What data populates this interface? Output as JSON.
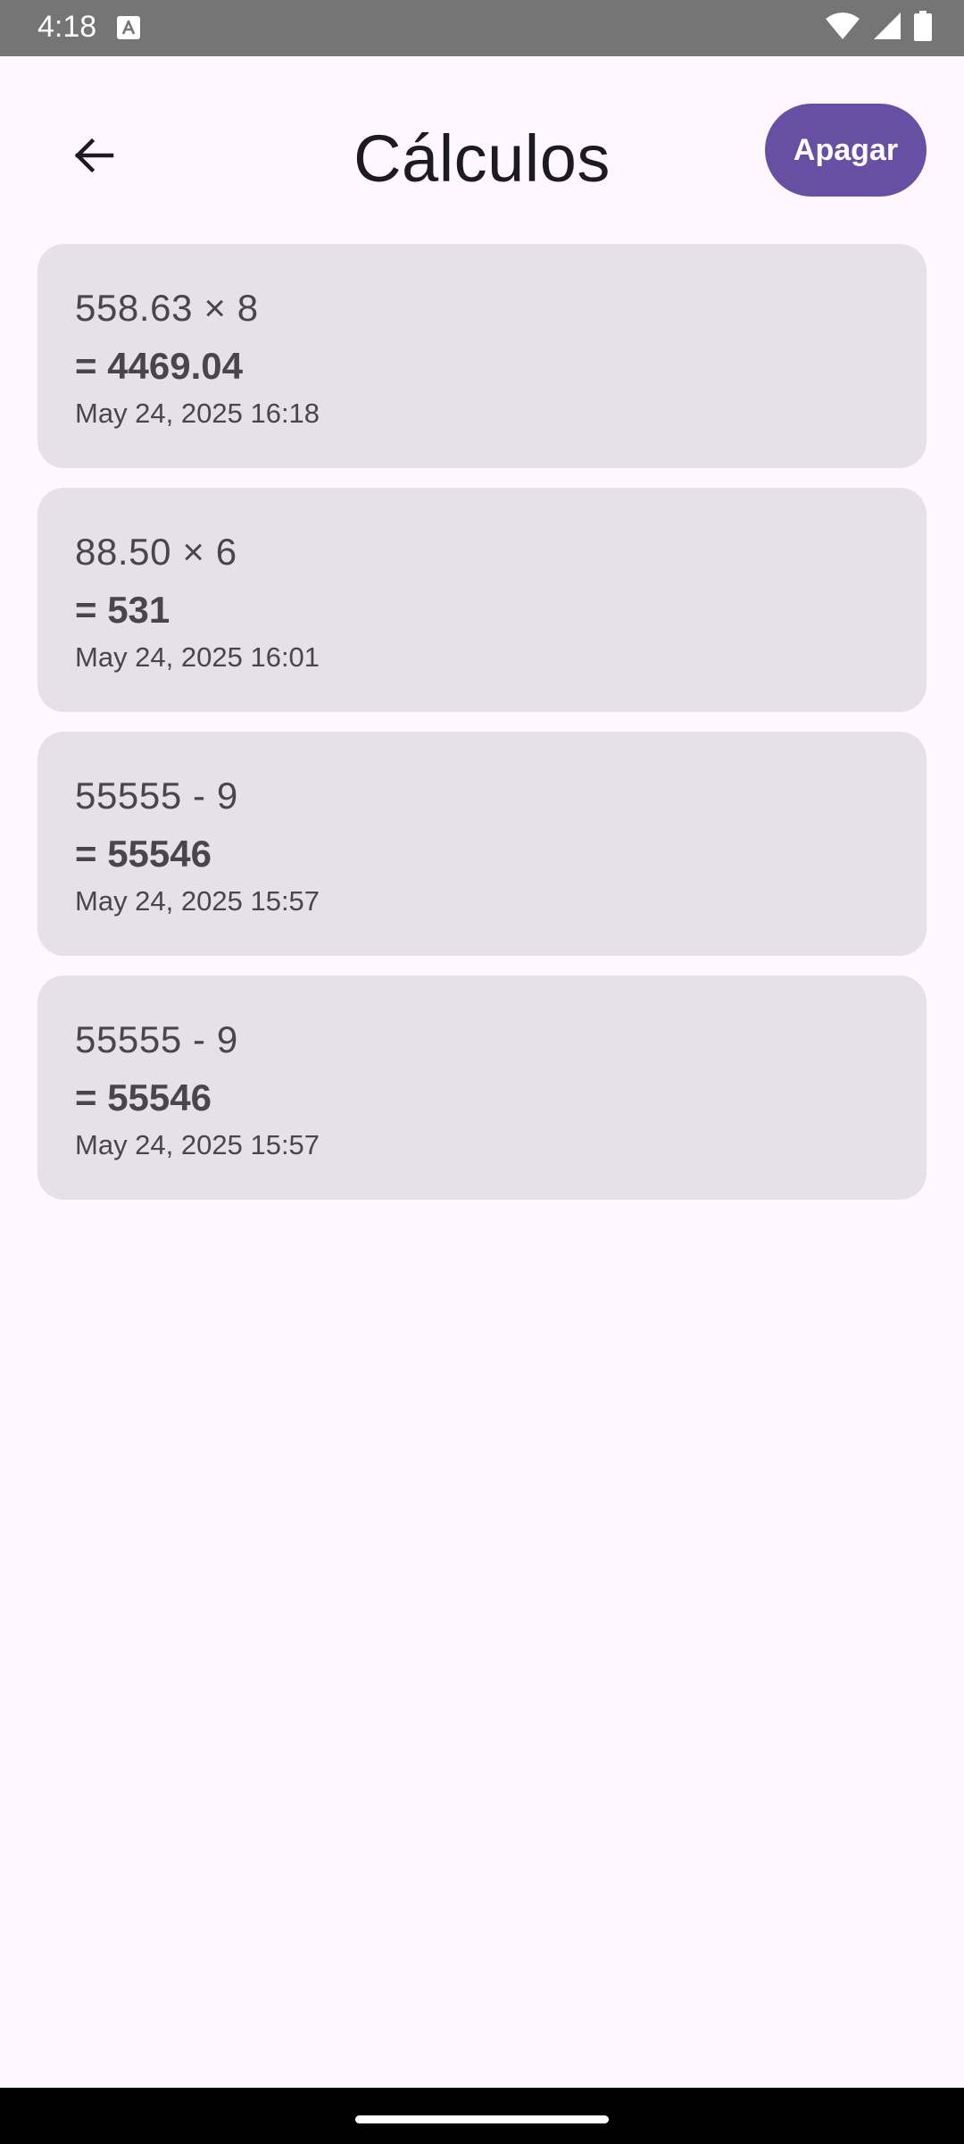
{
  "status_bar": {
    "time": "4:18"
  },
  "header": {
    "title": "Cálculos",
    "clear_label": "Apagar",
    "accent_color": "#6750A4"
  },
  "history": [
    {
      "expression": "558.63 × 8",
      "result": "= 4469.04",
      "timestamp": "May 24, 2025 16:18"
    },
    {
      "expression": "88.50 × 6",
      "result": "= 531",
      "timestamp": "May 24, 2025 16:01"
    },
    {
      "expression": "55555 - 9",
      "result": "= 55546",
      "timestamp": "May 24, 2025 15:57"
    },
    {
      "expression": "55555 - 9",
      "result": "= 55546",
      "timestamp": "May 24, 2025 15:57"
    }
  ],
  "icons": {
    "back": "arrow-back-icon",
    "wifi": "wifi-icon",
    "signal": "signal-icon",
    "battery": "battery-icon",
    "notification": "a-notification-icon"
  }
}
